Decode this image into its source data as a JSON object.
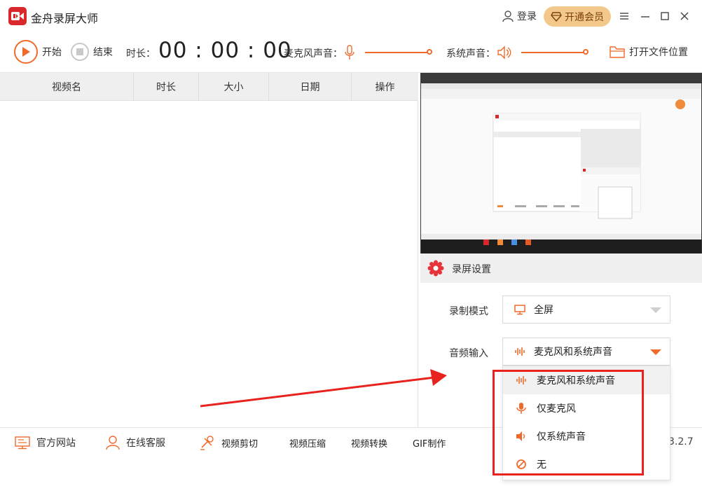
{
  "app": {
    "title": "金舟录屏大师"
  },
  "header": {
    "login_label": "登录",
    "vip_label": "开通会员"
  },
  "toolbar": {
    "start_label": "开始",
    "stop_label": "结束",
    "duration_label": "时长：",
    "timer": "00 : 00 : 00",
    "mic_label": "麦克风声音：",
    "system_label": "系统声音：",
    "open_folder_label": "打开文件位置"
  },
  "table": {
    "columns": [
      "视频名",
      "时长",
      "大小",
      "日期",
      "操作"
    ],
    "rows": []
  },
  "settings": {
    "title": "录屏设置",
    "mode_label": "录制模式",
    "mode_value": "全屏",
    "audio_label": "音频输入",
    "audio_value": "麦克风和系统声音"
  },
  "dropdown": {
    "options": [
      {
        "label": "麦克风和系统声音",
        "icon": "audio-wave-icon"
      },
      {
        "label": "仅麦克风",
        "icon": "microphone-icon"
      },
      {
        "label": "仅系统声音",
        "icon": "speaker-icon"
      },
      {
        "label": "无",
        "icon": "no-entry-icon"
      }
    ],
    "selected_index": 0
  },
  "footer": {
    "website": "官方网站",
    "support": "在线客服",
    "video_cut": "视频剪切",
    "video_compress": "视频压缩",
    "video_convert": "视频转换",
    "gif": "GIF制作",
    "version": "3.2.7"
  },
  "colors": {
    "accent": "#ef6b2c",
    "brand_red": "#d9282b",
    "vip": "#f3c98b",
    "annotation_red": "#e8231f"
  }
}
